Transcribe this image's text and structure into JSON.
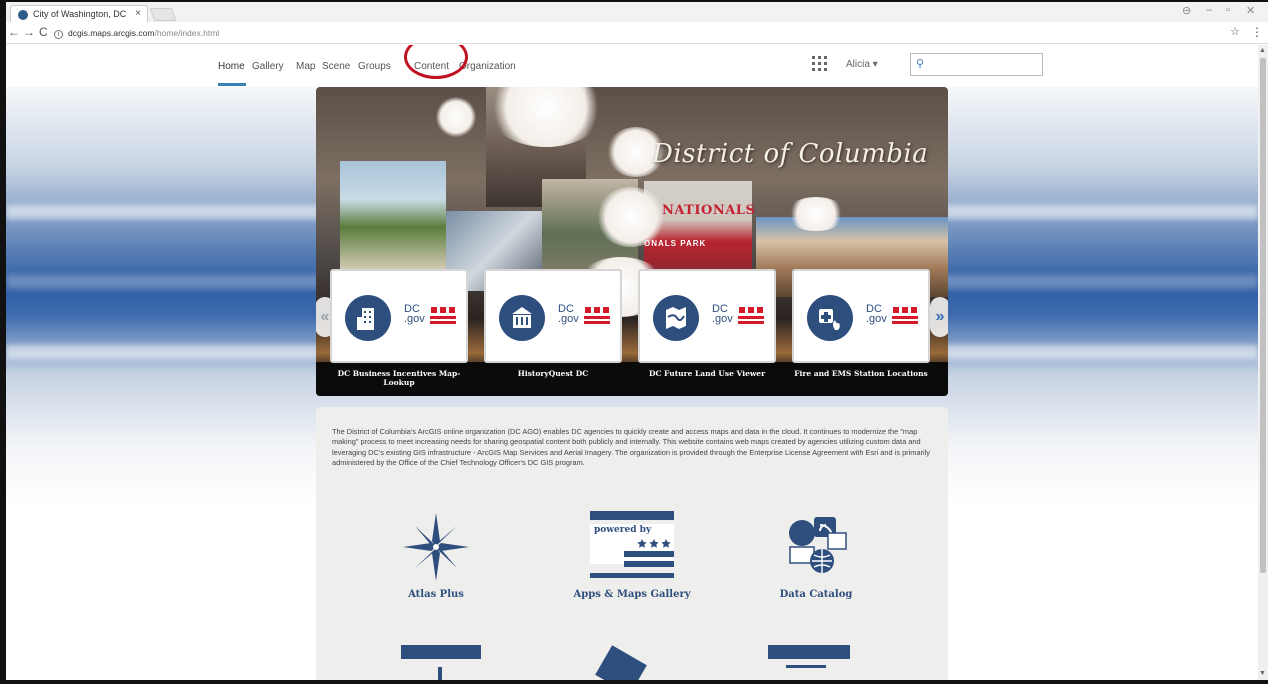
{
  "browser": {
    "tab_title": "City of Washington, DC",
    "tab_close": "×",
    "url_host": "dcgis.maps.arcgis.com",
    "url_path": "/home/index.html",
    "info_glyph": "i",
    "back": "←",
    "forward": "→",
    "reload": "C",
    "star": "☆",
    "menu": "⋮",
    "win_profile": "⊖",
    "win_min": "–",
    "win_max": "▫",
    "win_close": "✕"
  },
  "nav": {
    "items": [
      "Home",
      "Gallery",
      "Map",
      "Scene",
      "Groups",
      "Content",
      "Organization"
    ],
    "active": "Home",
    "annotated_item": "Content",
    "user": "Alicia ▾",
    "search_placeholder": "",
    "search_icon": "search-icon"
  },
  "banner": {
    "title": "District of Columbia",
    "sign_text": "NATIONALS",
    "sign_text_2": "ONALS PARK"
  },
  "carousel": {
    "prev": "«",
    "next": "»",
    "dc_label": "DC",
    "gov_label": ".gov",
    "cards": [
      {
        "title": "DC Business Incentives Map-Lookup",
        "icon": "building-icon"
      },
      {
        "title": "HistoryQuest DC",
        "icon": "historic-building-icon"
      },
      {
        "title": "DC Future Land Use Viewer",
        "icon": "map-icon"
      },
      {
        "title": "Fire and EMS Station Locations",
        "icon": "firefighter-icon"
      }
    ]
  },
  "intro": {
    "text": "The District of Columbia's ArcGIS online organization (DC AGO) enables DC agencies to quickly create and access maps and data in the cloud. It continues to modernize the \"map making\" process to meet increasing needs for sharing geospatial content both publicly and internally. This website contains web maps created by agencies utilizing custom data and leveraging DC's existing GIS infrastructure - ArcGIS Map Services and Aerial Imagery. The organization is provided through the Enterprise License Agreement with Esri and is primarily administered by the Office of the Chief Technology Officer's DC GIS program."
  },
  "features": [
    {
      "label": "Atlas Plus",
      "icon": "compass-rose-icon"
    },
    {
      "label": "Apps & Maps Gallery",
      "icon": "powered-by-dc-icon",
      "icon_text": "powered by"
    },
    {
      "label": "Data Catalog",
      "icon": "data-catalog-icon"
    }
  ],
  "colors": {
    "accent": "#3b7fb7",
    "dc_navy": "#2e4e7e",
    "dc_red": "#d4192b",
    "annotation": "#c1121f"
  }
}
